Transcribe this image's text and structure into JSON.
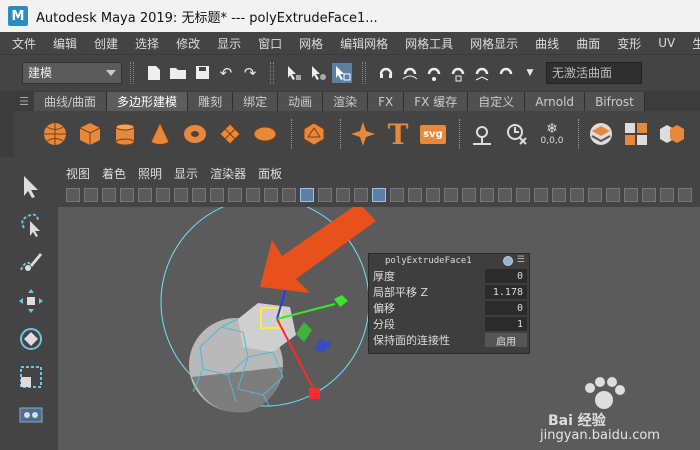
{
  "window": {
    "app_logo": "M",
    "title": "Autodesk Maya 2019: 无标题*    ---    polyExtrudeFace1..."
  },
  "menubar": [
    "文件",
    "编辑",
    "创建",
    "选择",
    "修改",
    "显示",
    "窗口",
    "网格",
    "编辑网格",
    "网格工具",
    "网格显示",
    "曲线",
    "曲面",
    "变形",
    "UV",
    "生成"
  ],
  "statusline": {
    "mode": "建模",
    "live_surface": "无激活曲面",
    "icons": [
      "new-scene-icon",
      "open-scene-icon",
      "save-scene-icon",
      "undo-icon",
      "redo-icon",
      "select-by-hierarchy-icon",
      "select-by-object-icon",
      "select-by-component-icon",
      "snap-grid-icon",
      "snap-curve-icon",
      "snap-point-icon",
      "snap-view-icon",
      "snap-surface-icon",
      "snap-live-icon"
    ]
  },
  "shelf": {
    "tabs": [
      {
        "label": "曲线/曲面",
        "active": false
      },
      {
        "label": "多边形建模",
        "active": true
      },
      {
        "label": "雕刻",
        "active": false
      },
      {
        "label": "绑定",
        "active": false
      },
      {
        "label": "动画",
        "active": false
      },
      {
        "label": "渲染",
        "active": false
      },
      {
        "label": "FX",
        "active": false
      },
      {
        "label": "FX 缓存",
        "active": false
      },
      {
        "label": "自定义",
        "active": false
      },
      {
        "label": "Arnold",
        "active": false
      },
      {
        "label": "Bifrost",
        "active": false
      }
    ],
    "text_tool_glyph": "T",
    "svg_tool_label": "svg",
    "particle_label": "0,0,0"
  },
  "panel": {
    "menu": [
      "视图",
      "着色",
      "照明",
      "显示",
      "渲染器",
      "面板"
    ]
  },
  "inout_box": {
    "title": "polyExtrudeFace1",
    "attributes": [
      {
        "label": "厚度",
        "value": "0"
      },
      {
        "label": "局部平移 Z",
        "value": "1.178"
      },
      {
        "label": "偏移",
        "value": "0"
      },
      {
        "label": "分段",
        "value": "1"
      },
      {
        "label": "保持面的连接性",
        "value": "启用"
      }
    ]
  },
  "watermark": {
    "brand": "Bai 经验",
    "url": "jingyan.baidu.com"
  },
  "colors": {
    "accent": "#5d7fa6",
    "arrow": "#e8501c",
    "sphere_wire": "#6ee0ff"
  }
}
